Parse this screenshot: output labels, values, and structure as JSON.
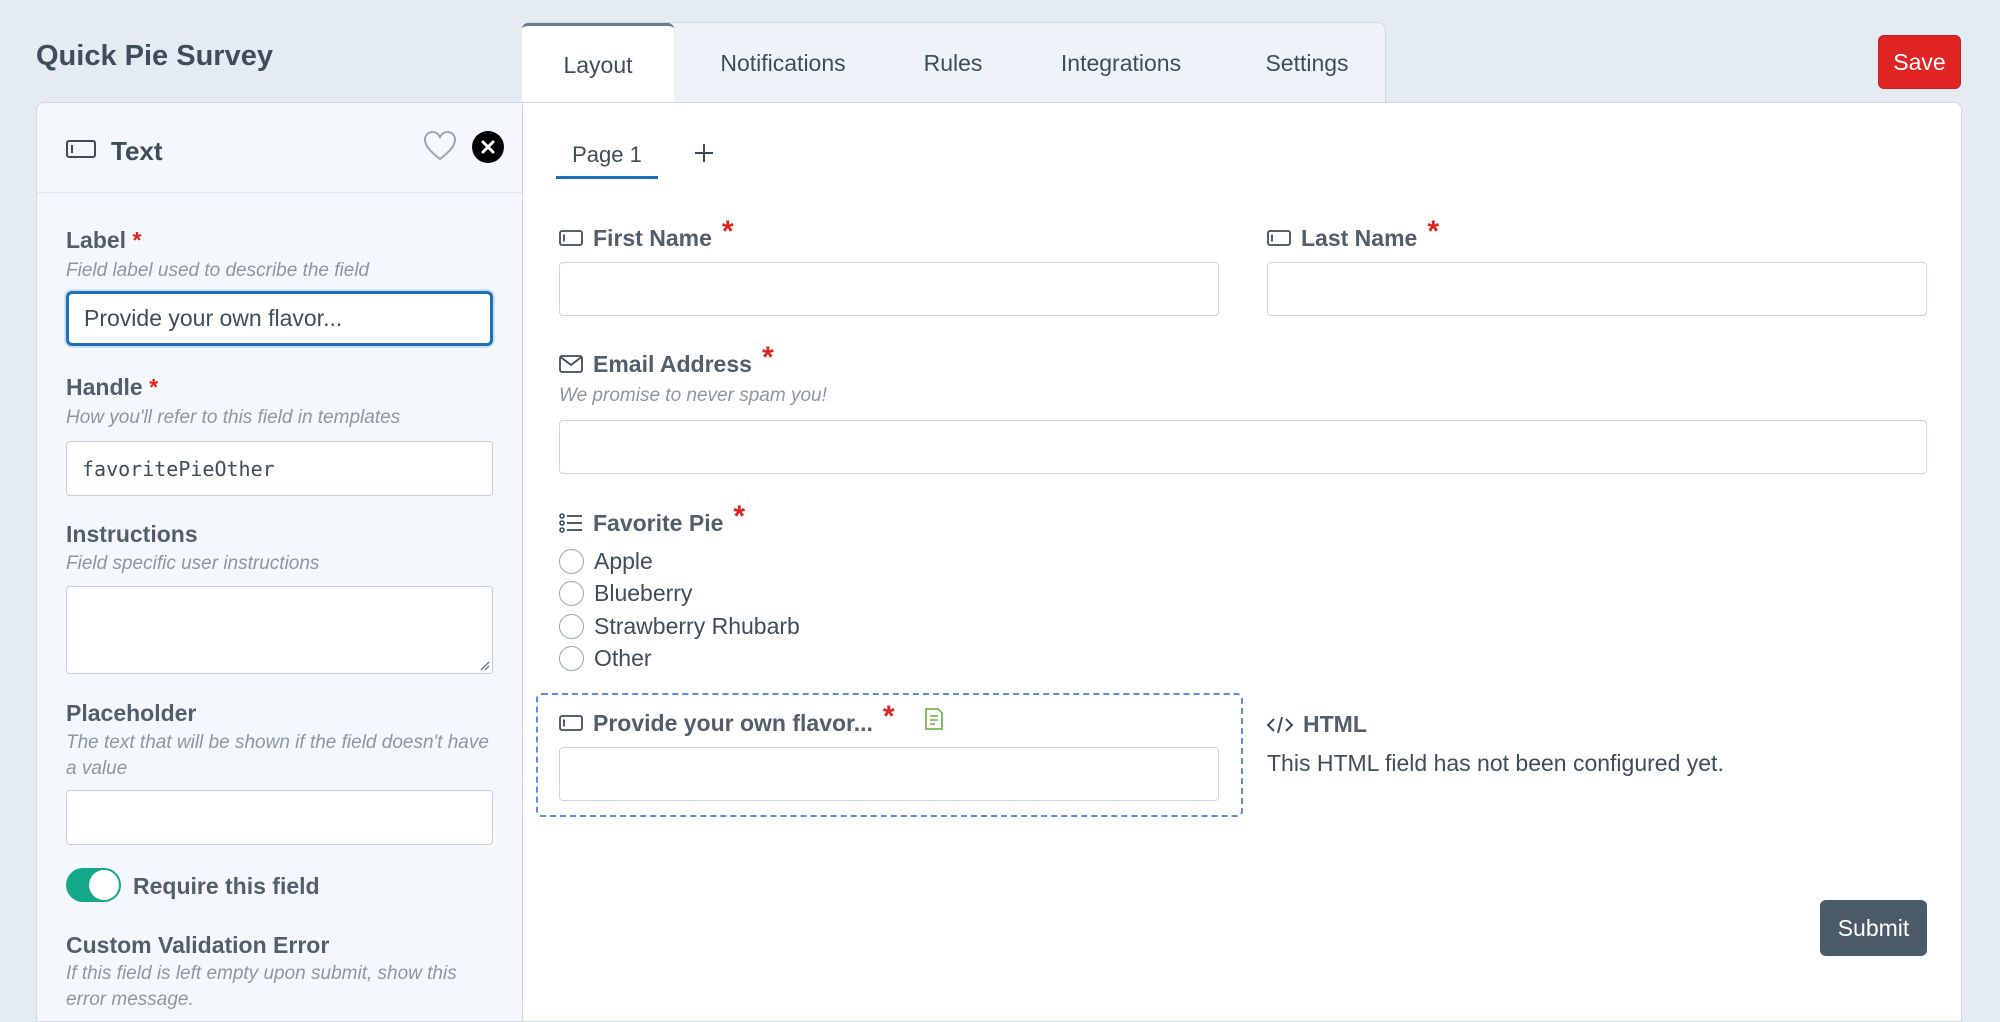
{
  "app": {
    "title": "Quick Pie Survey",
    "save_label": "Save"
  },
  "tabs": [
    {
      "label": "Layout",
      "active": true
    },
    {
      "label": "Notifications"
    },
    {
      "label": "Rules"
    },
    {
      "label": "Integrations"
    },
    {
      "label": "Settings"
    }
  ],
  "sidebar": {
    "header": {
      "title": "Text",
      "icon": "text-field-icon"
    },
    "label": {
      "title": "Label",
      "help": "Field label used to describe the field",
      "value": "Provide your own flavor..."
    },
    "handle": {
      "title": "Handle",
      "help": "How you'll refer to this field in templates",
      "value": "favoritePieOther"
    },
    "instructions": {
      "title": "Instructions",
      "help": "Field specific user instructions",
      "value": ""
    },
    "placeholder": {
      "title": "Placeholder",
      "help": "The text that will be shown if the field doesn't have a value",
      "value": ""
    },
    "require": {
      "label": "Require this field",
      "on": true
    },
    "custom_error": {
      "title": "Custom Validation Error",
      "help": "If this field is left empty upon submit, show this error message."
    }
  },
  "page_tabs": [
    {
      "label": "Page 1"
    }
  ],
  "form": {
    "first_name": {
      "label": "First Name"
    },
    "last_name": {
      "label": "Last Name"
    },
    "email": {
      "label": "Email Address",
      "help": "We promise to never spam you!"
    },
    "favorite_pie": {
      "label": "Favorite Pie",
      "options": [
        "Apple",
        "Blueberry",
        "Strawberry Rhubarb",
        "Other"
      ]
    },
    "other_flavor": {
      "label": "Provide your own flavor..."
    },
    "html_field": {
      "label": "HTML",
      "message": "This HTML field has not been configured yet."
    },
    "submit_label": "Submit"
  },
  "colors": {
    "required": "#e02424",
    "save": "#e02424",
    "toggle": "#13a88a",
    "focus": "#1f6fb6",
    "selection": "#5b8de6"
  }
}
